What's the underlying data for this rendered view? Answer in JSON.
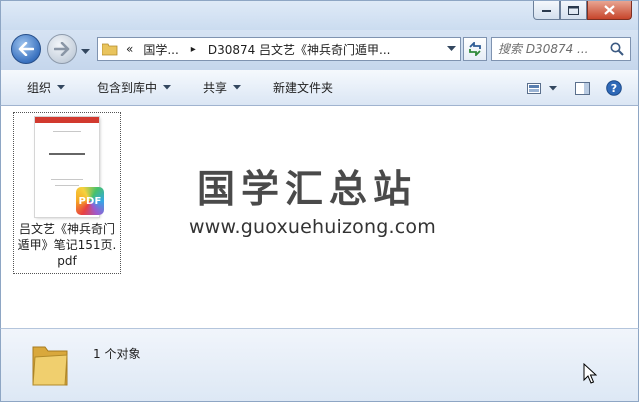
{
  "window": {
    "minimize_icon": "minimize-icon",
    "maximize_icon": "maximize-icon",
    "close_icon": "close-icon"
  },
  "address": {
    "chevrons": "«",
    "crumb_root": "国学...",
    "separator": "▸",
    "crumb_current": "D30874 吕文艺《神兵奇门遁甲...",
    "search_placeholder": "搜索 D30874 ..."
  },
  "toolbar": {
    "organize": "组织",
    "include_in_library": "包含到库中",
    "share": "共享",
    "new_folder": "新建文件夹"
  },
  "files": [
    {
      "name_line1": "吕文艺《神兵奇门",
      "name_line2": "遁甲》笔记151页.",
      "name_line3": "pdf",
      "badge": "PDF",
      "thumb_title": "神 兵 奇 门 遁 甲"
    }
  ],
  "watermark": {
    "title": "国学汇总站",
    "url": "www.guoxuehuizong.com"
  },
  "details": {
    "count": "1 个对象"
  },
  "colors": {
    "accent": "#3a72c0",
    "pdf_red": "#d23a2f",
    "close_red": "#c7452b"
  }
}
